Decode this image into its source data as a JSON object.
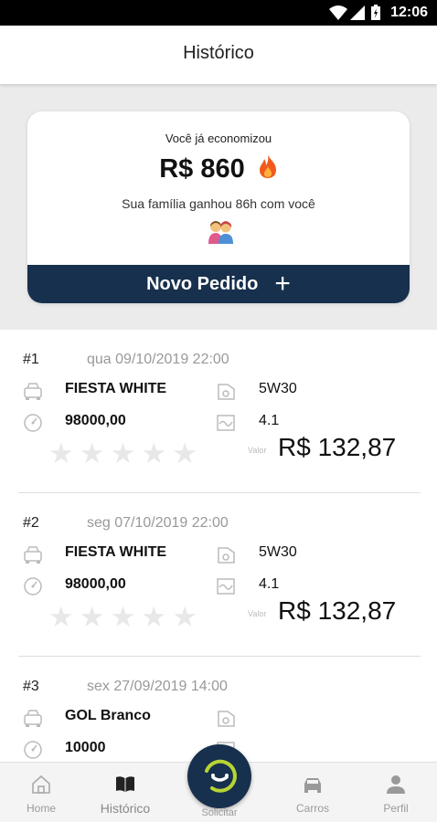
{
  "status_bar": {
    "time": "12:06"
  },
  "app_bar": {
    "title": "Histórico"
  },
  "savings_card": {
    "saved_label": "Você já economizou",
    "amount": "R$ 860",
    "family_text": "Sua família ganhou 86h com você",
    "new_order_label": "Novo Pedido",
    "new_order_plus": "+"
  },
  "orders": [
    {
      "number": "#1",
      "date": "qua 09/10/2019 22:00",
      "car": "FIESTA WHITE",
      "oil": "5W30",
      "km": "98000,00",
      "liters": "4.1",
      "rating": 0,
      "value_label": "Valor",
      "price": "R$ 132,87"
    },
    {
      "number": "#2",
      "date": "seg 07/10/2019 22:00",
      "car": "FIESTA WHITE",
      "oil": "5W30",
      "km": "98000,00",
      "liters": "4.1",
      "rating": 0,
      "value_label": "Valor",
      "price": "R$ 132,87"
    },
    {
      "number": "#3",
      "date": "sex 27/09/2019 14:00",
      "car": "GOL Branco",
      "oil": "",
      "km": "10000",
      "liters": "",
      "rating": 0,
      "value_label": "",
      "price": ""
    }
  ],
  "bottom_nav": {
    "items": [
      {
        "label": "Home",
        "icon": "home-icon"
      },
      {
        "label": "Histórico",
        "icon": "book-icon"
      },
      {
        "label": "Solicitar",
        "icon": "logo-icon"
      },
      {
        "label": "Carros",
        "icon": "car-icon"
      },
      {
        "label": "Perfil",
        "icon": "person-icon"
      }
    ],
    "active": "Histórico"
  },
  "colors": {
    "primary": "#17304d",
    "accent": "#b8d433",
    "fire": "#f25a1d"
  }
}
